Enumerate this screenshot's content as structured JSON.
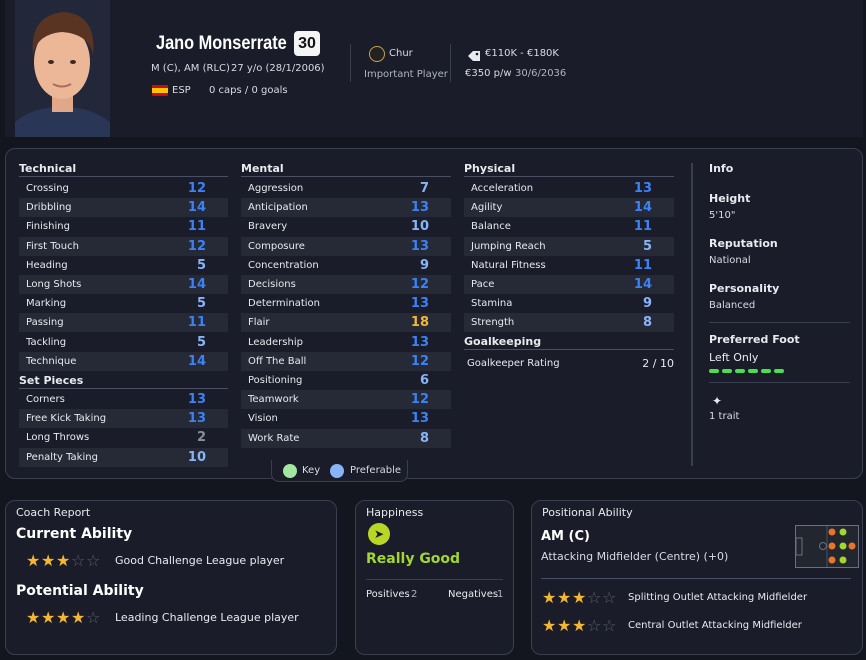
{
  "player": {
    "name": "Jano Monserrate",
    "number": "30",
    "positions": "M (C), AM (RLC)",
    "age_dob": "27 y/o (28/1/2006)",
    "nation_code": "ESP",
    "caps_goals": "0 caps / 0 goals",
    "club": "Chur",
    "club_role": "Important Player",
    "value": "€110K - €180K",
    "wage": "€350 p/w",
    "contract": "30/6/2036"
  },
  "attributes": {
    "technical_title": "Technical",
    "technical": [
      {
        "label": "Crossing",
        "value": "12"
      },
      {
        "label": "Dribbling",
        "value": "14"
      },
      {
        "label": "Finishing",
        "value": "11"
      },
      {
        "label": "First Touch",
        "value": "12"
      },
      {
        "label": "Heading",
        "value": "5"
      },
      {
        "label": "Long Shots",
        "value": "14"
      },
      {
        "label": "Marking",
        "value": "5"
      },
      {
        "label": "Passing",
        "value": "11"
      },
      {
        "label": "Tackling",
        "value": "5"
      },
      {
        "label": "Technique",
        "value": "14"
      }
    ],
    "set_pieces_title": "Set Pieces",
    "set_pieces": [
      {
        "label": "Corners",
        "value": "13"
      },
      {
        "label": "Free Kick Taking",
        "value": "13"
      },
      {
        "label": "Long Throws",
        "value": "2"
      },
      {
        "label": "Penalty Taking",
        "value": "10"
      }
    ],
    "mental_title": "Mental",
    "mental": [
      {
        "label": "Aggression",
        "value": "7"
      },
      {
        "label": "Anticipation",
        "value": "13"
      },
      {
        "label": "Bravery",
        "value": "10"
      },
      {
        "label": "Composure",
        "value": "13"
      },
      {
        "label": "Concentration",
        "value": "9"
      },
      {
        "label": "Decisions",
        "value": "12"
      },
      {
        "label": "Determination",
        "value": "13"
      },
      {
        "label": "Flair",
        "value": "18"
      },
      {
        "label": "Leadership",
        "value": "13"
      },
      {
        "label": "Off The Ball",
        "value": "12"
      },
      {
        "label": "Positioning",
        "value": "6"
      },
      {
        "label": "Teamwork",
        "value": "12"
      },
      {
        "label": "Vision",
        "value": "13"
      },
      {
        "label": "Work Rate",
        "value": "8"
      }
    ],
    "physical_title": "Physical",
    "physical": [
      {
        "label": "Acceleration",
        "value": "13"
      },
      {
        "label": "Agility",
        "value": "14"
      },
      {
        "label": "Balance",
        "value": "11"
      },
      {
        "label": "Jumping Reach",
        "value": "5"
      },
      {
        "label": "Natural Fitness",
        "value": "11"
      },
      {
        "label": "Pace",
        "value": "14"
      },
      {
        "label": "Stamina",
        "value": "9"
      },
      {
        "label": "Strength",
        "value": "8"
      }
    ],
    "goalkeeping_title": "Goalkeeping",
    "gk_label": "Goalkeeper Rating",
    "gk_value": "2 / 10",
    "legend_key": "Key",
    "legend_pref": "Preferable",
    "colors": {
      "blue": "#3b82f6",
      "light_blue": "#8ab4f8",
      "gray": "#8a8f9c",
      "gold": "#f5b731",
      "key_dot": "#a3e6a0",
      "pref_dot": "#8ab4f8"
    }
  },
  "info": {
    "title": "Info",
    "height_label": "Height",
    "height": "5'10\"",
    "reputation_label": "Reputation",
    "reputation": "National",
    "personality_label": "Personality",
    "personality": "Balanced",
    "foot_label": "Preferred Foot",
    "foot": "Left Only",
    "traits": "1 trait"
  },
  "coach": {
    "title": "Coach Report",
    "ca_label": "Current Ability",
    "ca_stars": 3,
    "ca_text": "Good Challenge League player",
    "pa_label": "Potential Ability",
    "pa_stars": 4,
    "pa_text": "Leading Challenge League player"
  },
  "happiness": {
    "title": "Happiness",
    "status": "Really Good",
    "positives_label": "Positives",
    "positives": "2",
    "negatives_label": "Negatives",
    "negatives": "1"
  },
  "positional": {
    "title": "Positional Ability",
    "position": "AM (C)",
    "description": "Attacking Midfielder (Centre) (+0)",
    "roles": [
      {
        "stars": 3,
        "label": "Splitting Outlet Attacking Midfielder"
      },
      {
        "stars": 3,
        "label": "Central Outlet Attacking Midfielder"
      }
    ]
  }
}
